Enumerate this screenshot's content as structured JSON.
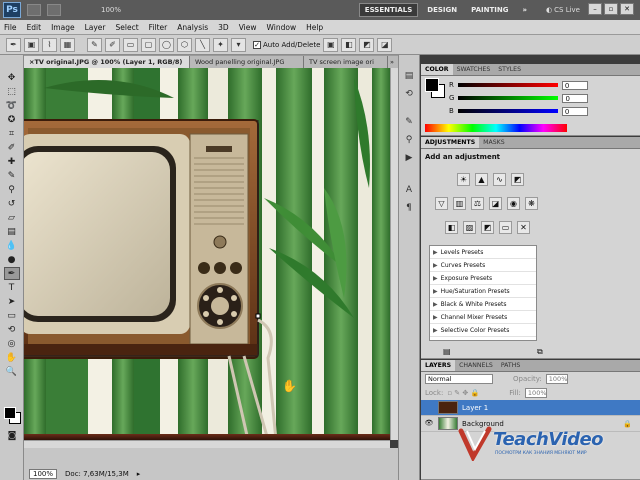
{
  "appbar": {
    "logo": "Ps",
    "zoom": "100%",
    "workspaces": [
      "ESSENTIALS",
      "DESIGN",
      "PAINTING"
    ],
    "more": "»",
    "cs_live": "CS Live"
  },
  "menu": [
    "File",
    "Edit",
    "Image",
    "Layer",
    "Select",
    "Filter",
    "Analysis",
    "3D",
    "View",
    "Window",
    "Help"
  ],
  "options": {
    "auto_add_delete": "Auto Add/Delete"
  },
  "doc_tabs": [
    {
      "label": "TV original.JPG @ 100% (Layer 1, RGB/8)",
      "active": true
    },
    {
      "label": "Wood panelling original.JPG",
      "active": false
    },
    {
      "label": "TV screen image ori",
      "active": false
    }
  ],
  "status": {
    "zoom": "100%",
    "doc": "Doc: 7,63M/15,3M"
  },
  "color_panel": {
    "tabs": [
      "COLOR",
      "SWATCHES",
      "STYLES"
    ],
    "channels": [
      {
        "label": "R",
        "value": "0",
        "bar_color": "#e02020"
      },
      {
        "label": "G",
        "value": "0",
        "bar_color": "#20c020"
      },
      {
        "label": "B",
        "value": "0",
        "bar_color": "#2040e0"
      }
    ]
  },
  "adjustments_panel": {
    "tabs": [
      "ADJUSTMENTS",
      "MASKS"
    ],
    "title": "Add an adjustment",
    "presets": [
      "Levels Presets",
      "Curves Presets",
      "Exposure Presets",
      "Hue/Saturation Presets",
      "Black & White Presets",
      "Channel Mixer Presets",
      "Selective Color Presets"
    ]
  },
  "layers_panel": {
    "tabs": [
      "LAYERS",
      "CHANNELS",
      "PATHS"
    ],
    "blend_mode": "Normal",
    "opacity_label": "Opacity:",
    "opacity": "100%",
    "lock_label": "Lock:",
    "fill_label": "Fill:",
    "fill": "100%",
    "layers": [
      {
        "name": "Layer 1",
        "active": true
      },
      {
        "name": "Background",
        "active": false
      }
    ]
  },
  "watermark": {
    "brand": "TeachVideo",
    "tagline": "ПОСМОТРИ КАК ЗНАНИЯ МЕНЯЮТ МИР"
  },
  "colors": {
    "app_dark": "#5a5a5a",
    "panel_bg": "#d4d4d4",
    "selection_blue": "#3f79c4",
    "brand_blue": "#2b63b0"
  }
}
